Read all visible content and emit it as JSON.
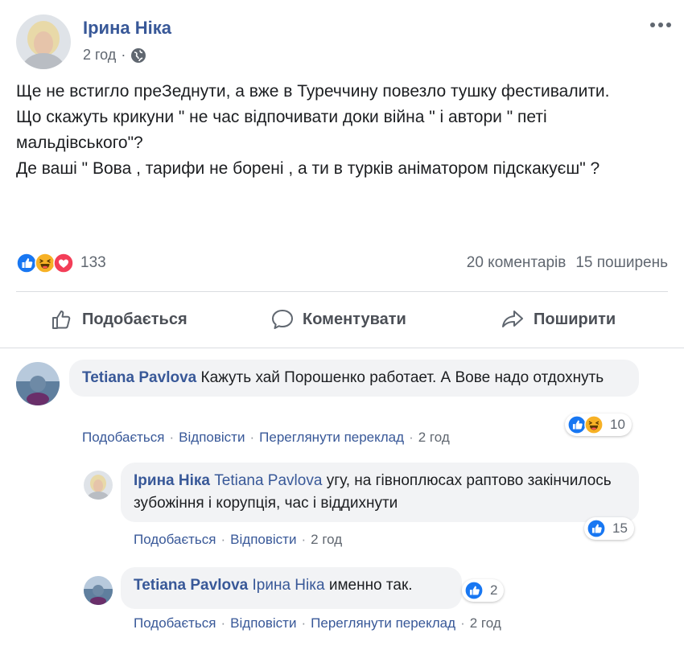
{
  "post": {
    "author": "Ірина Ніка",
    "time": "2 год",
    "text_lines": [
      "Ще не встигло преЗеднути, а вже в Туреччину повезло тушку фестивалити.",
      "Що скажуть крикуни \" не час відпочивати доки війна \" і автори \" петі мальдівського\"?",
      "Де ваші \" Вова , тарифи не борені , а ти в турків аніматором підскакуєш\" ?"
    ],
    "reaction_count": "133",
    "comments_count": "20 коментарів",
    "shares_count": "15 поширень",
    "more_icon": "more-horizontal-icon",
    "privacy_icon": "globe-icon"
  },
  "actions": {
    "like": "Подобається",
    "comment": "Коментувати",
    "share": "Поширити"
  },
  "comments": [
    {
      "author": "Tetiana Pavlova",
      "text": "Кажуть хай Порошенко работает. А Вове надо отдохнуть",
      "reactions": "10",
      "actions": [
        "Подобається",
        "Відповісти",
        "Переглянути переклад",
        "2 год"
      ]
    },
    {
      "author": "Ірина Ніка",
      "mention": "Tetiana Pavlova",
      "text": "угу, на гівноплюсах раптово закінчилось зубожіння і корупція, час і віддихнути",
      "reactions": "15",
      "actions": [
        "Подобається",
        "Відповісти",
        "2 год"
      ]
    },
    {
      "author": "Tetiana Pavlova",
      "mention": "Ірина Ніка",
      "text": "именно так.",
      "reactions": "2",
      "actions": [
        "Подобається",
        "Відповісти",
        "Переглянути переклад",
        "2 год"
      ]
    }
  ],
  "colors": {
    "link": "#385898",
    "like_blue": "#1877f2",
    "love_red": "#f33e58",
    "haha_yellow": "#f7b125"
  }
}
